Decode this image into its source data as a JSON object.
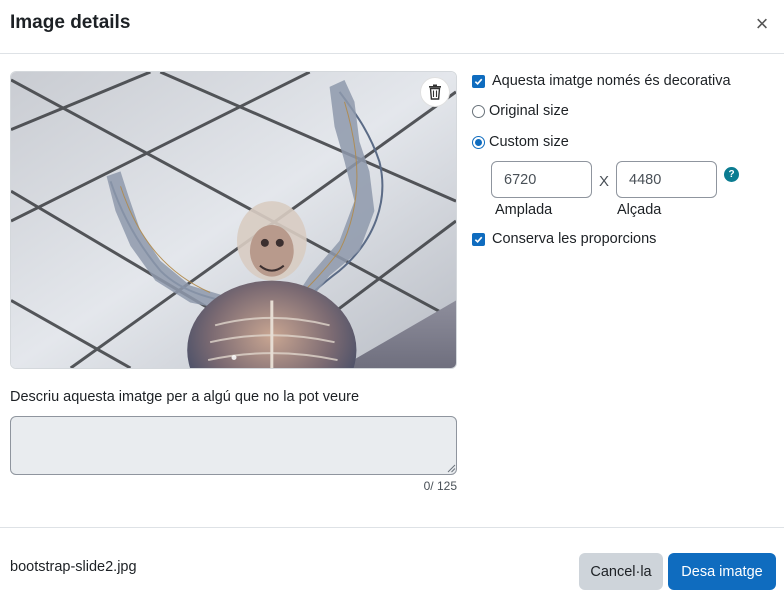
{
  "dialog": {
    "title": "Image details",
    "close_label": "×"
  },
  "preview": {
    "image_alt": "Anatomical human figure sculpture with raised arms under a ceiling grid",
    "delete_icon": "trash-icon"
  },
  "alt_text": {
    "label": "Descriu aquesta imatge per a algú que no la pot veure",
    "value": "",
    "counter": "0/ 125"
  },
  "options": {
    "decorative_label": "Aquesta imatge només és decorativa",
    "decorative_checked": true,
    "original_size_label": "Original size",
    "custom_size_label": "Custom size",
    "selected_size": "custom",
    "width_value": "6720",
    "height_value": "4480",
    "separator": "X",
    "width_label": "Amplada",
    "height_label": "Alçada",
    "help_icon": "?",
    "keep_ratio_label": "Conserva les proporcions",
    "keep_ratio_checked": true
  },
  "footer": {
    "filename": "bootstrap-slide2.jpg",
    "cancel_label": "Cancel·la",
    "save_label": "Desa imatge"
  },
  "colors": {
    "primary": "#0f6cbf",
    "secondary": "#ced4da",
    "help": "#0b7c91"
  }
}
